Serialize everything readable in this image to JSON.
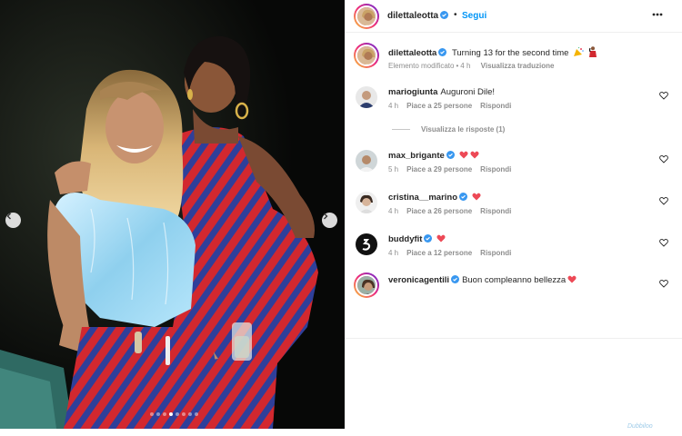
{
  "post": {
    "author": "dilettaleotta",
    "follow_label": "Segui",
    "separator": "•",
    "caption_text": "Turning 13 for the second time",
    "caption_meta_edited": "Elemento modificato",
    "caption_meta_time": "4 h",
    "caption_meta_translate": "Visualizza traduzione",
    "photo_index": 4,
    "photo_count": 8
  },
  "comments": [
    {
      "user": "mariogiunta",
      "verified": false,
      "text": "Auguroni Dile!",
      "hearts": 0,
      "time": "4 h",
      "likes": "Piace a 25 persone",
      "reply": "Rispondi"
    },
    {
      "user": "max_brigante",
      "verified": true,
      "text": "",
      "hearts": 2,
      "time": "5 h",
      "likes": "Piace a 29 persone",
      "reply": "Rispondi"
    },
    {
      "user": "cristina__marino",
      "verified": true,
      "text": "",
      "hearts": 1,
      "time": "4 h",
      "likes": "Piace a 26 persone",
      "reply": "Rispondi"
    },
    {
      "user": "buddyfit",
      "verified": true,
      "text": "",
      "hearts": 1,
      "time": "4 h",
      "likes": "Piace a 12 persone",
      "reply": "Rispondi"
    },
    {
      "user": "veronicagentili",
      "verified": true,
      "text": "Buon compleanno bellezza",
      "hearts": 1,
      "time": "",
      "likes": "",
      "reply": ""
    }
  ],
  "view_replies_label": "Visualizza le risposte (1)",
  "watermark": "Dubbiloo",
  "colors": {
    "link_blue": "#0095f6",
    "verified_blue": "#3897f0",
    "heart_red": "#ed4956",
    "muted_text": "#8e8e8e"
  },
  "icons": {
    "more": "more-options-icon",
    "verified": "verified-badge-icon",
    "like": "heart-outline-icon",
    "prev": "chevron-left-icon",
    "next": "chevron-right-icon"
  }
}
